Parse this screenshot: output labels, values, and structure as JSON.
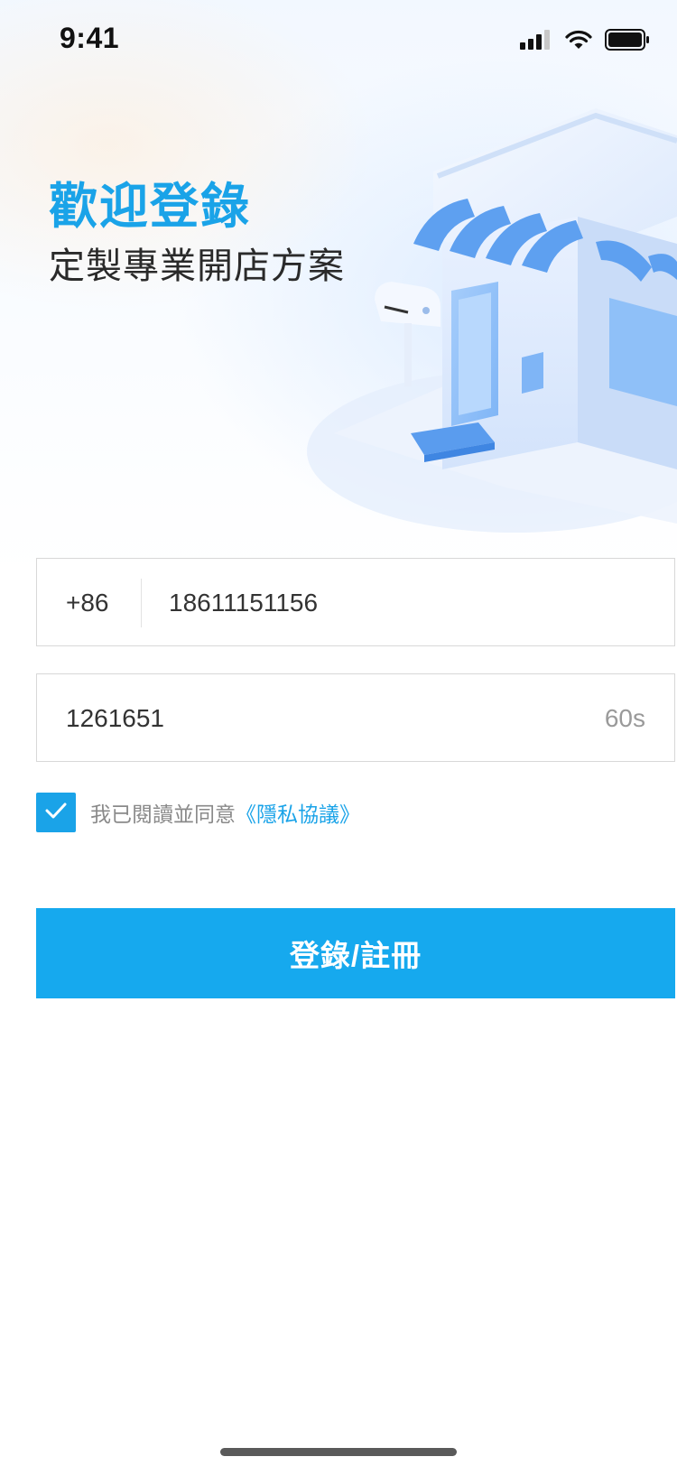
{
  "status_bar": {
    "time": "9:41",
    "icons": [
      "signal-icon",
      "wifi-icon",
      "battery-icon"
    ]
  },
  "header": {
    "title": "歡迎登錄",
    "subtitle": "定製專業開店方案"
  },
  "illustration": {
    "icon": "storefront-illustration"
  },
  "form": {
    "phone": {
      "country_code": "+86",
      "value": "18611151156"
    },
    "code": {
      "value": "1261651",
      "countdown": "60s"
    },
    "agreement": {
      "checked": true,
      "text": "我已閱讀並同意",
      "link": "《隱私協議》"
    },
    "submit_label": "登錄/註冊"
  },
  "colors": {
    "accent": "#1aa3e8",
    "button": "#16a9ee",
    "text": "#333333",
    "muted": "#8a8a8a"
  }
}
